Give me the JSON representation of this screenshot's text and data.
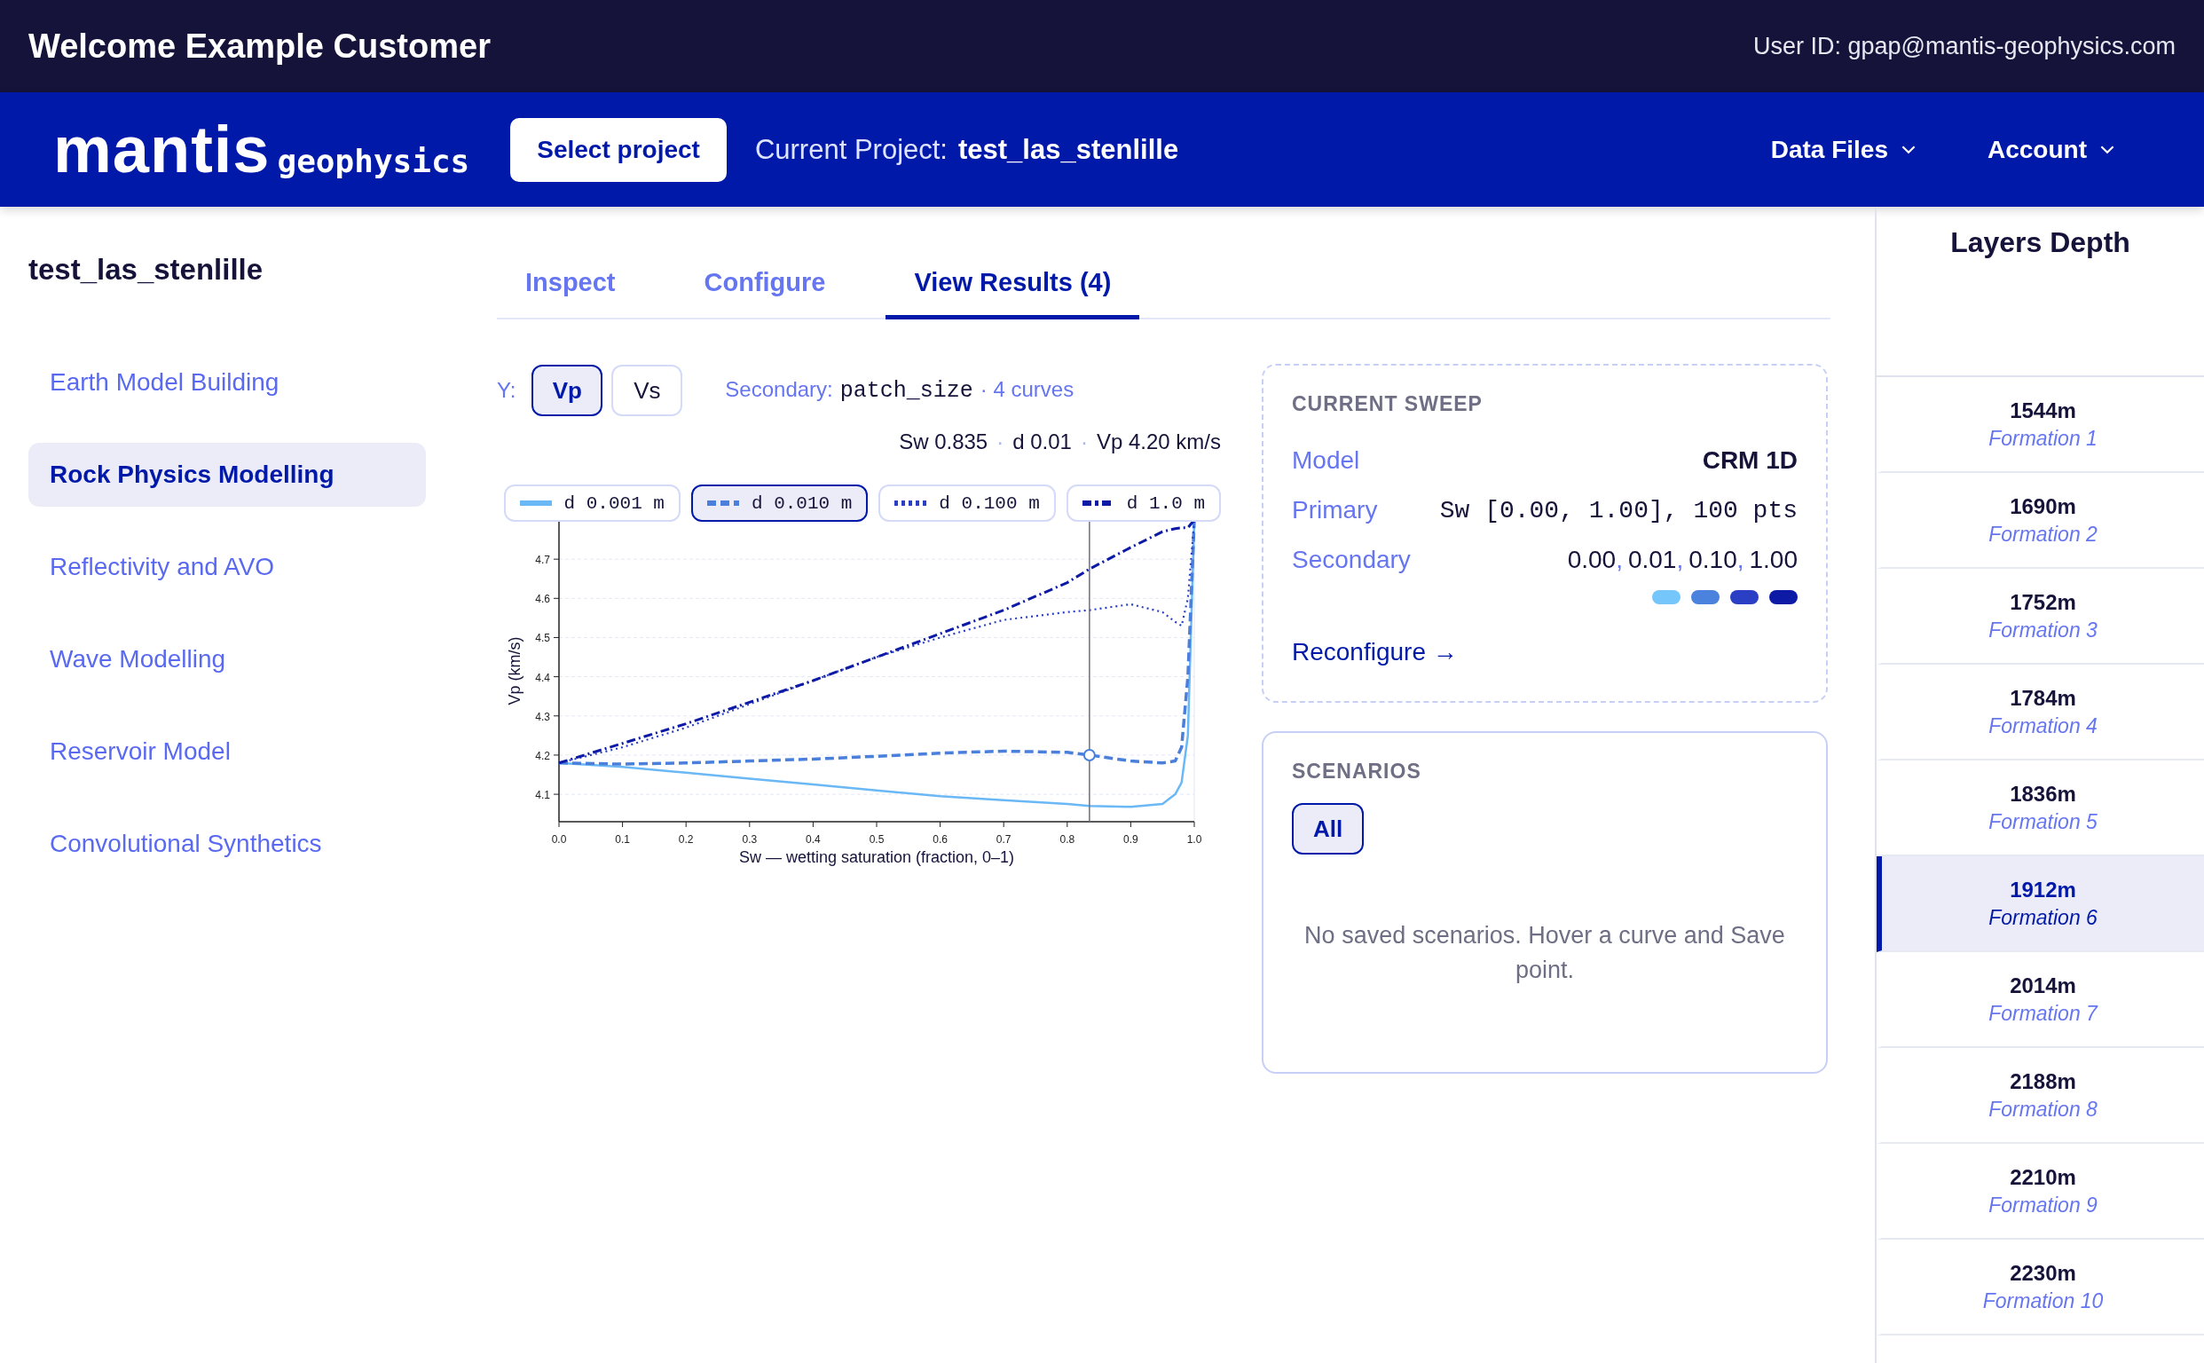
{
  "top_bar": {
    "welcome": "Welcome Example Customer",
    "user_id": "User ID: gpap@mantis-geophysics.com"
  },
  "nav": {
    "logo_main": "mantis",
    "logo_sub": "geophysics",
    "select_button": "Select project",
    "project_label": "Current Project:",
    "project_name": "test_las_stenlille",
    "menus": [
      {
        "label": "Data Files"
      },
      {
        "label": "Account"
      }
    ]
  },
  "sidebar": {
    "title": "test_las_stenlille",
    "items": [
      {
        "label": "Earth Model Building",
        "selected": false
      },
      {
        "label": "Rock Physics Modelling",
        "selected": true
      },
      {
        "label": "Reflectivity and AVO",
        "selected": false
      },
      {
        "label": "Wave Modelling",
        "selected": false
      },
      {
        "label": "Reservoir Model",
        "selected": false
      },
      {
        "label": "Convolutional Synthetics",
        "selected": false
      }
    ]
  },
  "tabs": [
    {
      "label": "Inspect",
      "selected": false
    },
    {
      "label": "Configure",
      "selected": false
    },
    {
      "label": "View Results (4)",
      "selected": true
    }
  ],
  "controls": {
    "y_label": "Y:",
    "y_options": [
      {
        "label": "Vp",
        "selected": true
      },
      {
        "label": "Vs",
        "selected": false
      }
    ],
    "secondary_label": "Secondary:",
    "secondary_value": "patch_size",
    "curve_count": "· 4 curves"
  },
  "readout": {
    "separator": "·",
    "parts": [
      "Sw 0.835",
      "d 0.01",
      "Vp 4.20 km/s"
    ]
  },
  "legend": [
    {
      "selected": false
    },
    {
      "selected": true
    },
    {
      "selected": false
    },
    {
      "selected": false
    }
  ],
  "chart_data": {
    "type": "line",
    "grid": true,
    "xlabel": "Sw — wetting saturation (fraction, 0–1)",
    "ylabel": "Vp (km/s)",
    "x": [
      0,
      0.1,
      0.2,
      0.3,
      0.4,
      0.5,
      0.6,
      0.7,
      0.8,
      0.835,
      0.9,
      0.95,
      0.97,
      0.98,
      0.99,
      1.0
    ],
    "series": [
      {
        "name": "d 0.001 m",
        "color": "#6ab8f5",
        "line_style": "solid",
        "values": [
          4.18,
          4.17,
          4.155,
          4.14,
          4.125,
          4.11,
          4.095,
          4.085,
          4.075,
          4.07,
          4.068,
          4.075,
          4.1,
          4.13,
          4.25,
          4.8
        ]
      },
      {
        "name": "d 0.010 m",
        "color": "#4a7fdc",
        "line_style": "dashed",
        "values": [
          4.18,
          4.177,
          4.18,
          4.185,
          4.19,
          4.197,
          4.205,
          4.21,
          4.207,
          4.2,
          4.185,
          4.18,
          4.185,
          4.22,
          4.4,
          4.8
        ]
      },
      {
        "name": "d 0.100 m",
        "color": "#2a3fc4",
        "line_style": "dotted",
        "values": [
          4.18,
          4.22,
          4.27,
          4.33,
          4.39,
          4.45,
          4.5,
          4.545,
          4.565,
          4.57,
          4.585,
          4.565,
          4.54,
          4.53,
          4.6,
          4.8
        ]
      },
      {
        "name": "d 1.0 m",
        "color": "#0c1aa6",
        "line_style": "dashdot",
        "values": [
          4.18,
          4.23,
          4.28,
          4.335,
          4.39,
          4.45,
          4.51,
          4.57,
          4.64,
          4.675,
          4.73,
          4.77,
          4.778,
          4.78,
          4.78,
          4.8
        ]
      }
    ],
    "xlim": [
      0,
      1
    ],
    "ylim": [
      4.03,
      4.8
    ],
    "xticks": [
      {
        "value": 0,
        "label": "0.0"
      },
      {
        "value": 0.1,
        "label": "0.1"
      },
      {
        "value": 0.2,
        "label": "0.2"
      },
      {
        "value": 0.3,
        "label": "0.3"
      },
      {
        "value": 0.4,
        "label": "0.4"
      },
      {
        "value": 0.5,
        "label": "0.5"
      },
      {
        "value": 0.6,
        "label": "0.6"
      },
      {
        "value": 0.7,
        "label": "0.7"
      },
      {
        "value": 0.8,
        "label": "0.8"
      },
      {
        "value": 0.9,
        "label": "0.9"
      },
      {
        "value": 1,
        "label": "1.0"
      }
    ],
    "yticks": [
      4.1,
      4.2,
      4.3,
      4.4,
      4.5,
      4.6,
      4.7
    ],
    "ref_lines": [
      {
        "axis": "x",
        "value": 0.835
      }
    ]
  },
  "sweep": {
    "title": "CURRENT SWEEP",
    "rows": [
      {
        "label": "Model",
        "value": "CRM 1D",
        "kind": "bold"
      },
      {
        "label": "Primary",
        "value": "Sw [0.00, 1.00], 100 pts",
        "kind": "mono"
      },
      {
        "label": "Secondary",
        "values": [
          "0.00",
          "0.01",
          "0.10",
          "1.00"
        ],
        "separator": ",",
        "kind": "list"
      }
    ],
    "swatches": [
      {
        "color": "#74c6fb"
      },
      {
        "color": "#4b82dd"
      },
      {
        "color": "#2a3fc4"
      },
      {
        "color": "#0c1aa6"
      }
    ],
    "link": "Reconfigure →"
  },
  "scenarios": {
    "title": "SCENARIOS",
    "filters": [
      {
        "label": "All",
        "selected": true
      }
    ],
    "empty": "No saved scenarios. Hover a curve and Save point."
  },
  "layers": {
    "title": "Layers Depth",
    "items": [
      {
        "depth": "1544m",
        "formation": "Formation 1",
        "selected": false
      },
      {
        "depth": "1690m",
        "formation": "Formation 2",
        "selected": false
      },
      {
        "depth": "1752m",
        "formation": "Formation 3",
        "selected": false
      },
      {
        "depth": "1784m",
        "formation": "Formation 4",
        "selected": false
      },
      {
        "depth": "1836m",
        "formation": "Formation 5",
        "selected": false
      },
      {
        "depth": "1912m",
        "formation": "Formation 6",
        "selected": true
      },
      {
        "depth": "2014m",
        "formation": "Formation 7",
        "selected": false
      },
      {
        "depth": "2188m",
        "formation": "Formation 8",
        "selected": false
      },
      {
        "depth": "2210m",
        "formation": "Formation 9",
        "selected": false
      },
      {
        "depth": "2230m",
        "formation": "Formation 10",
        "selected": false
      }
    ]
  }
}
